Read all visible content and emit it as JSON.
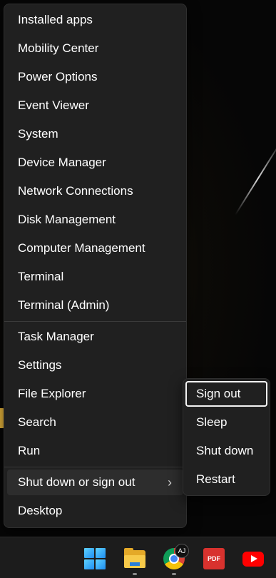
{
  "menu": {
    "items": [
      {
        "label": "Installed apps"
      },
      {
        "label": "Mobility Center"
      },
      {
        "label": "Power Options"
      },
      {
        "label": "Event Viewer"
      },
      {
        "label": "System"
      },
      {
        "label": "Device Manager"
      },
      {
        "label": "Network Connections"
      },
      {
        "label": "Disk Management"
      },
      {
        "label": "Computer Management"
      },
      {
        "label": "Terminal"
      },
      {
        "label": "Terminal (Admin)"
      },
      {
        "label": "Task Manager"
      },
      {
        "label": "Settings"
      },
      {
        "label": "File Explorer"
      },
      {
        "label": "Search"
      },
      {
        "label": "Run"
      },
      {
        "label": "Shut down or sign out",
        "has_submenu": true,
        "chevron": "›"
      },
      {
        "label": "Desktop"
      }
    ]
  },
  "submenu": {
    "items": [
      {
        "label": "Sign out",
        "focused": true
      },
      {
        "label": "Sleep"
      },
      {
        "label": "Shut down"
      },
      {
        "label": "Restart"
      }
    ]
  },
  "taskbar": {
    "pdf_label": "PDF",
    "profile_badge": "AJ",
    "icons": [
      "windows-start-icon",
      "file-explorer-icon",
      "chrome-icon",
      "pdf-app-icon",
      "youtube-icon"
    ]
  },
  "colors": {
    "menu_bg": "#202020",
    "highlight": "#2d2d2d",
    "focus_border": "#f2f2f2",
    "taskbar_bg": "#1c1c1c"
  }
}
